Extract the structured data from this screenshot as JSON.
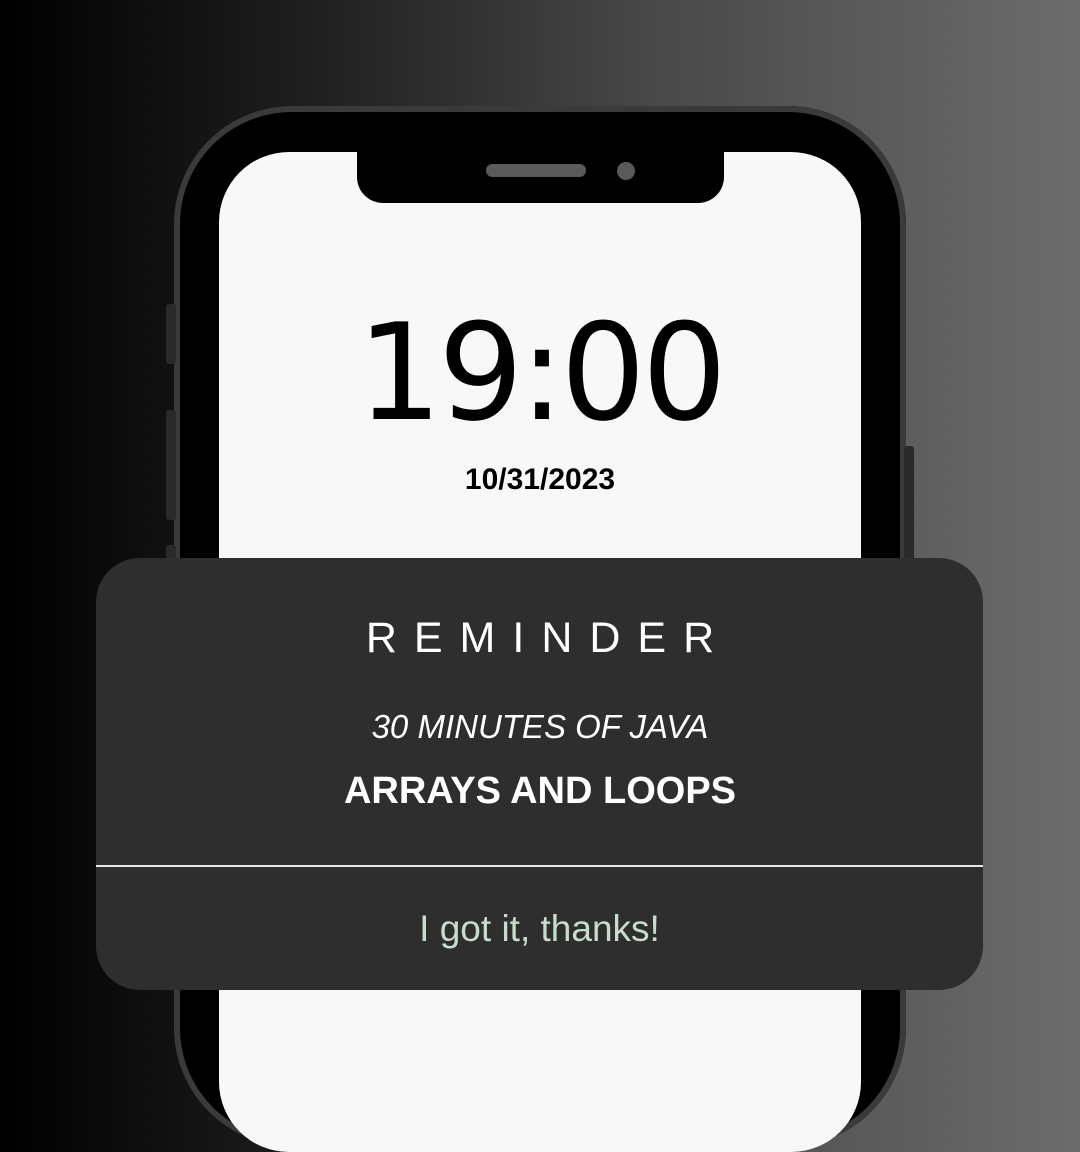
{
  "lockscreen": {
    "time": "19:00",
    "date": "10/31/2023"
  },
  "notification": {
    "title": "REMINDER",
    "subtitle": "30 MINUTES OF JAVA",
    "topic": "ARRAYS AND LOOPS",
    "action_label": "I got it, thanks!"
  },
  "colors": {
    "card_background": "#2e2e2e",
    "action_text": "#c8dccb",
    "screen_background": "#f8f8f8"
  }
}
